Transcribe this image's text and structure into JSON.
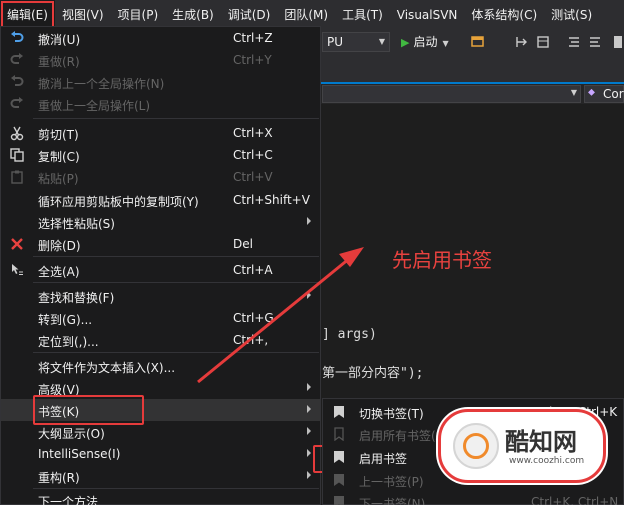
{
  "menubar": {
    "items": [
      "编辑(E)",
      "视图(V)",
      "项目(P)",
      "生成(B)",
      "调试(D)",
      "团队(M)",
      "工具(T)",
      "VisualSVN",
      "体系结构(C)",
      "测试(S)"
    ]
  },
  "toolbar": {
    "platform_value": "PU",
    "start_label": "启动"
  },
  "navbar": {
    "right_value": "Cor"
  },
  "code": {
    "line_args": "] args)",
    "line_string": "第一部分内容\");"
  },
  "edit_menu": {
    "items": [
      {
        "label": "撤消(U)",
        "shortcut": "Ctrl+Z",
        "icon": "undo-icon"
      },
      {
        "label": "重做(R)",
        "shortcut": "Ctrl+Y",
        "icon": "redo-icon"
      },
      {
        "label": "撤消上一个全局操作(N)",
        "shortcut": "",
        "icon": "global-undo-icon"
      },
      {
        "label": "重做上一全局操作(L)",
        "shortcut": "",
        "icon": "global-redo-icon"
      },
      {
        "label": "剪切(T)",
        "shortcut": "Ctrl+X",
        "icon": "cut-icon"
      },
      {
        "label": "复制(C)",
        "shortcut": "Ctrl+C",
        "icon": "copy-icon"
      },
      {
        "label": "粘贴(P)",
        "shortcut": "Ctrl+V",
        "icon": "paste-icon"
      },
      {
        "label": "循环应用剪贴板中的复制项(Y)",
        "shortcut": "Ctrl+Shift+V",
        "icon": ""
      },
      {
        "label": "选择性粘贴(S)",
        "shortcut": "",
        "icon": ""
      },
      {
        "label": "删除(D)",
        "shortcut": "Del",
        "icon": "delete-icon"
      },
      {
        "label": "全选(A)",
        "shortcut": "Ctrl+A",
        "icon": "select-all-icon"
      },
      {
        "label": "查找和替换(F)",
        "shortcut": "",
        "icon": ""
      },
      {
        "label": "转到(G)...",
        "shortcut": "Ctrl+G",
        "icon": ""
      },
      {
        "label": "定位到(,)...",
        "shortcut": "Ctrl+,",
        "icon": ""
      },
      {
        "label": "将文件作为文本插入(X)...",
        "shortcut": "",
        "icon": ""
      },
      {
        "label": "高级(V)",
        "shortcut": "",
        "icon": ""
      },
      {
        "label": "书签(K)",
        "shortcut": "",
        "icon": ""
      },
      {
        "label": "大纲显示(O)",
        "shortcut": "",
        "icon": ""
      },
      {
        "label": "IntelliSense(I)",
        "shortcut": "",
        "icon": ""
      },
      {
        "label": "重构(R)",
        "shortcut": "",
        "icon": ""
      },
      {
        "label": "下一个方法",
        "shortcut": "",
        "icon": ""
      }
    ]
  },
  "bookmark_menu": {
    "items": [
      {
        "label": "切换书签(T)",
        "shortcut": "Ctrl+K, Ctrl+K"
      },
      {
        "label": "启用所有书签(A)",
        "shortcut": ""
      },
      {
        "label": "启用书签",
        "shortcut": ""
      },
      {
        "label": "上一书签(P)",
        "shortcut": ""
      },
      {
        "label": "下一书签(N)",
        "shortcut": "Ctrl+K, Ctrl+N"
      }
    ]
  },
  "annotation": "先启用书签",
  "watermark": {
    "name": "酷知网",
    "url": "www.coozhi.com"
  },
  "colors": {
    "accent_red": "#e53b3b",
    "menu_bg": "#1b1b1c",
    "menubar_bg": "#2d2d30",
    "play_green": "#41b841"
  }
}
